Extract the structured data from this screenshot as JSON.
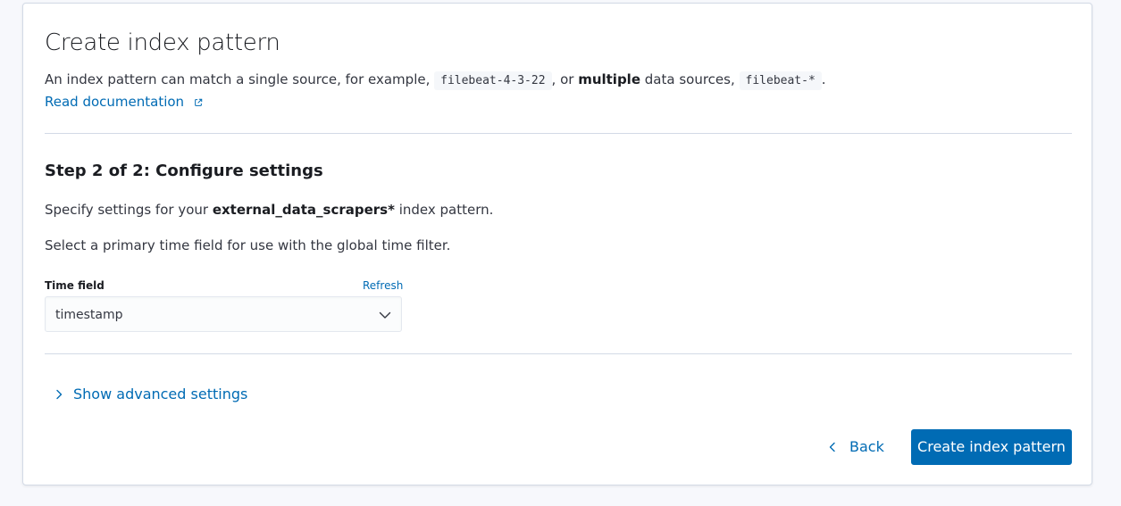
{
  "header": {
    "title": "Create index pattern",
    "description": {
      "part1": "An index pattern can match a single source, for example, ",
      "code1": "filebeat-4-3-22",
      "part2": ", or ",
      "bold": "multiple",
      "part3": " data sources, ",
      "code2": "filebeat-*",
      "part4": "."
    },
    "doc_link": "Read documentation",
    "doc_link_icon": "external-link-icon"
  },
  "step": {
    "title": "Step 2 of 2: Configure settings",
    "specify": {
      "prefix": "Specify settings for your ",
      "pattern": "external_data_scrapers*",
      "suffix": " index pattern."
    },
    "time_hint": "Select a primary time field for use with the global time filter."
  },
  "time_field": {
    "label": "Time field",
    "refresh": "Refresh",
    "selected": "timestamp",
    "chevron_icon": "chevron-down-icon"
  },
  "advanced": {
    "label": "Show advanced settings",
    "icon": "chevron-right-icon"
  },
  "footer": {
    "back_label": "Back",
    "back_icon": "chevron-left-icon",
    "create_label": "Create index pattern"
  },
  "colors": {
    "link": "#006bb4",
    "primary": "#006bb4",
    "text": "#343741",
    "border": "#d3dae6",
    "background": "#f7f8fc"
  }
}
